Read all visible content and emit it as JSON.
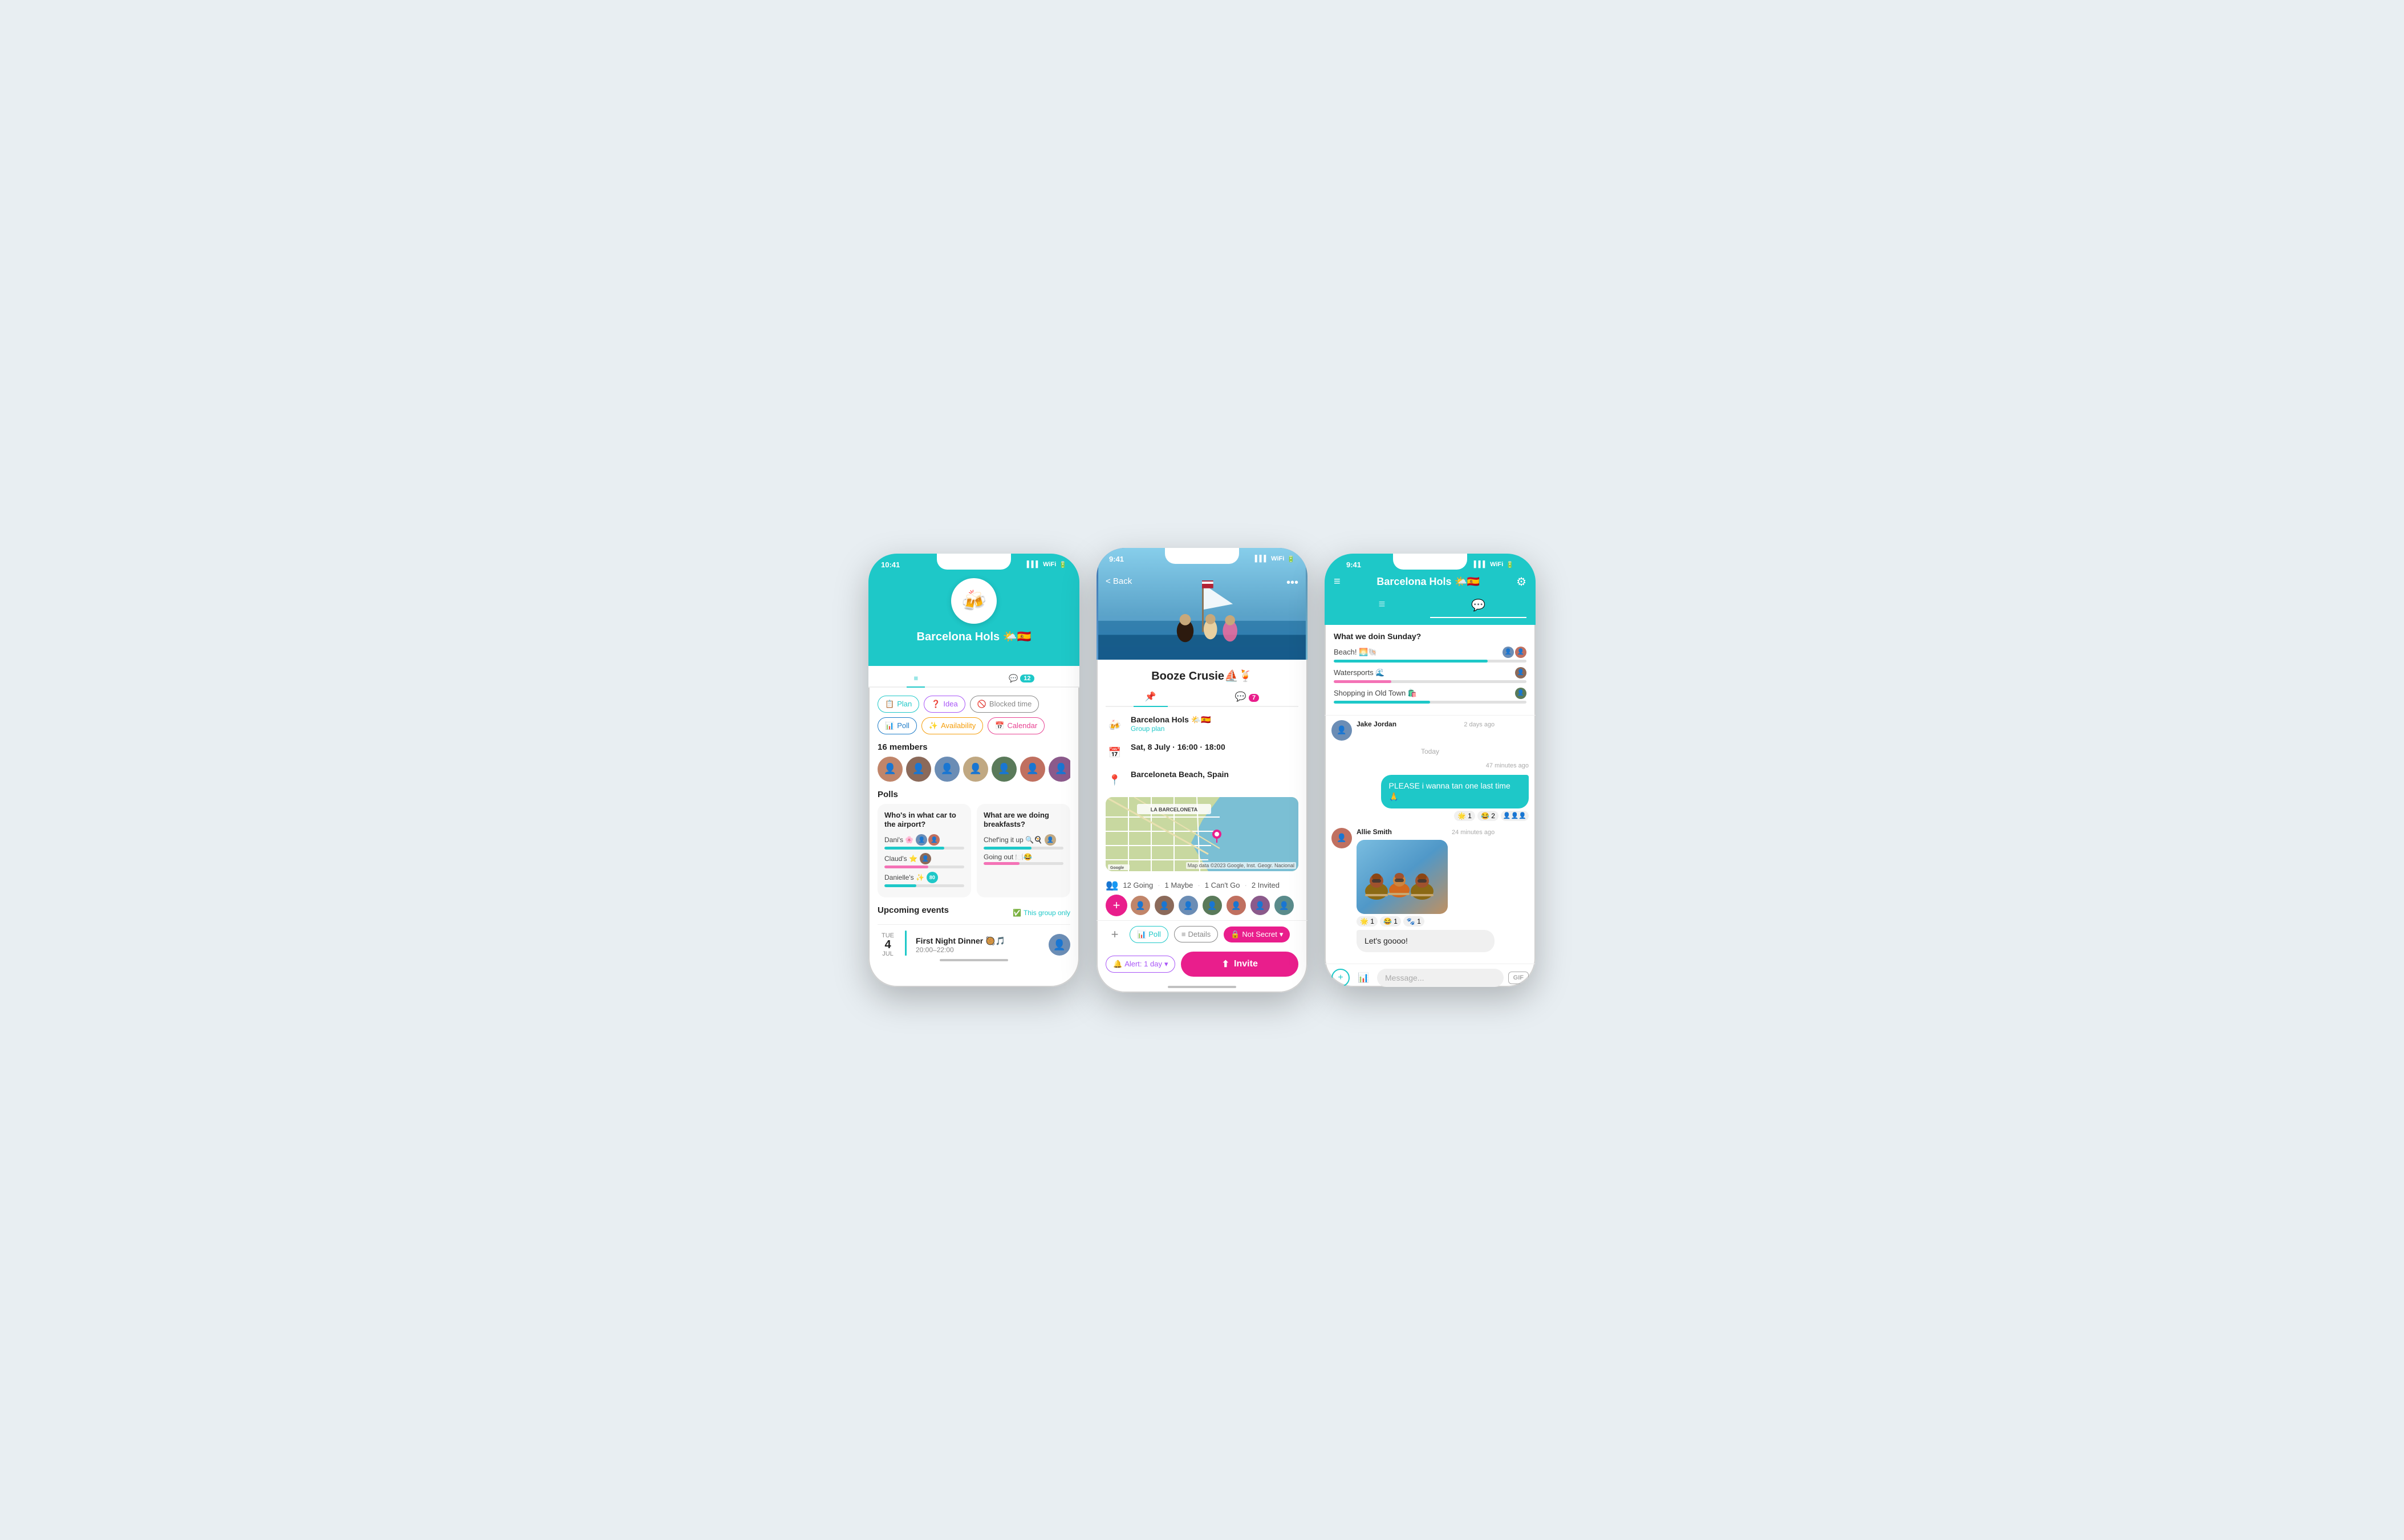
{
  "phone1": {
    "status_time": "10:41",
    "group_emoji": "🍻",
    "group_name": "Barcelona Hols 🌤️🇪🇸",
    "tab_list": "list",
    "tab_chat": "chat",
    "chat_badge": "12",
    "btn_plan": "Plan",
    "btn_idea": "Idea",
    "btn_blocked": "Blocked time",
    "btn_poll": "Poll",
    "btn_avail": "Availability",
    "btn_calendar": "Calendar",
    "members_count": "16 members",
    "polls_title": "Polls",
    "poll1_q": "Who's in what car to the airport?",
    "poll1_opt1": "Dani's 🌸",
    "poll1_opt2": "Claud's ⭐",
    "poll1_opt3": "Danielle's ✨",
    "poll1_bar1": 75,
    "poll1_bar2": 55,
    "poll1_bar3": 40,
    "poll2_q": "What are we doing breakfasts?",
    "poll2_opt1": "Chef'ing it up 🔍🍳",
    "poll2_opt2": "Going out 🍽️😂",
    "poll2_bar1": 60,
    "poll2_bar2": 45,
    "upcoming_title": "Upcoming events",
    "this_group": "This group only",
    "event_day_abbr": "TUE",
    "event_day_num": "4",
    "event_month": "JUL",
    "event_name": "First Night Dinner 🥘🎵",
    "event_time": "20:00–22:00"
  },
  "phone2": {
    "status_time": "9:41",
    "back_label": "< Back",
    "event_title": "Booze Crusie⛵🍹",
    "group_name": "Barcelona Hols 🌤️🇪🇸",
    "group_sub": "Group plan",
    "date_time": "Sat, 8 July · 16:00 · 18:00",
    "location": "Barceloneta Beach, Spain",
    "map_label": "LA BARCELONETA",
    "going_text": "12 Going",
    "maybe_text": "1 Maybe",
    "cantgo_text": "1 Can't Go",
    "invited_text": "2 Invited",
    "chat_badge": "7",
    "footer_poll": "Poll",
    "footer_details": "Details",
    "footer_secret": "Not Secret",
    "footer_alert": "Alert: 1 day",
    "footer_invite": "Invite",
    "not_secret_label": "Not Secret"
  },
  "phone3": {
    "status_time": "9:41",
    "group_name": "Barcelona Hols 🌤️🇪🇸",
    "poll_question": "What we doin Sunday?",
    "poll_opt1": "Beach! 🌅🐚",
    "poll_opt2": "Watersports 🌊",
    "poll_opt3": "Shopping in Old Town 🛍️",
    "poll_bar1": 80,
    "poll_bar2": 30,
    "poll_bar3": 50,
    "sender1": "Jake Jordan",
    "time1": "2 days ago",
    "sender2": "Allie Smith",
    "time2": "24 minutes ago",
    "sent_msg": "PLEASE i wanna tan one last time 🙏",
    "sent_time": "47 minutes ago",
    "received_msg": "Let's goooo!",
    "message_placeholder": "Message...",
    "gif_label": "GIF",
    "today_label": "Today"
  }
}
